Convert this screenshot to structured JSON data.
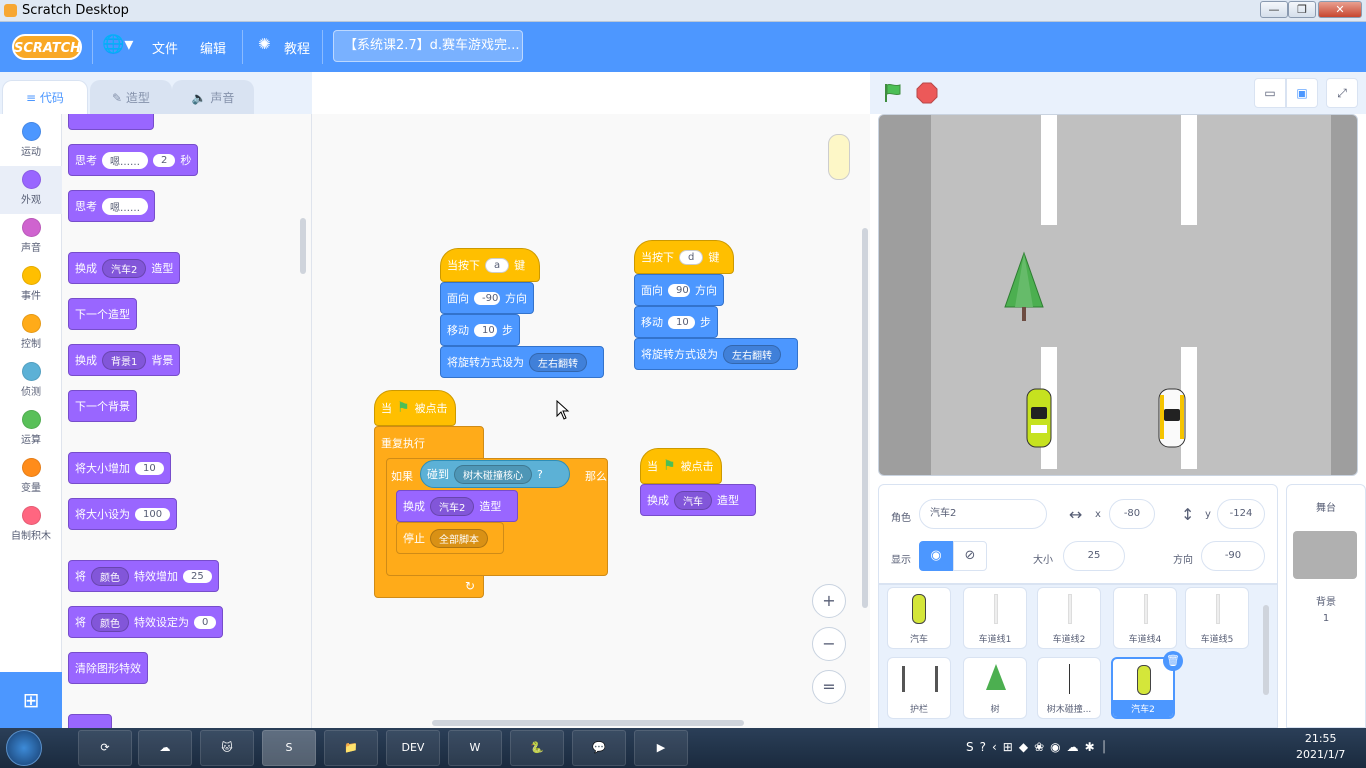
{
  "window": {
    "title": "Scratch Desktop"
  },
  "menubar": {
    "logo": "SCRATCH",
    "file": "文件",
    "edit": "编辑",
    "tutorials": "教程",
    "project_title": "【系统课2.7】d.赛车游戏完..."
  },
  "tabs": {
    "code": "代码",
    "costumes": "造型",
    "sounds": "声音"
  },
  "categories": [
    {
      "label": "运动",
      "color": "#4c97ff"
    },
    {
      "label": "外观",
      "color": "#9966ff"
    },
    {
      "label": "声音",
      "color": "#cf63cf"
    },
    {
      "label": "事件",
      "color": "#ffbf00"
    },
    {
      "label": "控制",
      "color": "#ffab19"
    },
    {
      "label": "侦测",
      "color": "#5cb1d6"
    },
    {
      "label": "运算",
      "color": "#59c059"
    },
    {
      "label": "变量",
      "color": "#ff8c1a"
    },
    {
      "label": "自制积木",
      "color": "#ff6680"
    }
  ],
  "palette": {
    "think_secs": {
      "label": "思考",
      "text": "嗯……",
      "secs": "2",
      "unit": "秒"
    },
    "think": {
      "label": "思考",
      "text": "嗯……"
    },
    "switch_costume": {
      "label": "换成",
      "value": "汽车2",
      "suffix": "造型"
    },
    "next_costume": "下一个造型",
    "switch_backdrop": {
      "label": "换成",
      "value": "背景1",
      "suffix": "背景"
    },
    "next_backdrop": "下一个背景",
    "change_size": {
      "label": "将大小增加",
      "value": "10"
    },
    "set_size": {
      "label": "将大小设为",
      "value": "100"
    },
    "change_effect": {
      "label": "将",
      "effect": "颜色",
      "mid": "特效增加",
      "value": "25"
    },
    "set_effect": {
      "label": "将",
      "effect": "颜色",
      "mid": "特效设定为",
      "value": "0"
    },
    "clear_effects": "清除图形特效"
  },
  "scripts": {
    "key_a": {
      "hat": "当按下",
      "key": "a",
      "key_suffix": "键",
      "dir_label": "面向",
      "dir": "-90",
      "dir_unit": "方向",
      "move_label": "移动",
      "steps": "10",
      "steps_unit": "步",
      "rot_label": "将旋转方式设为",
      "rot": "左右翻转"
    },
    "key_d": {
      "hat": "当按下",
      "key": "d",
      "key_suffix": "键",
      "dir_label": "面向",
      "dir": "90",
      "dir_unit": "方向",
      "move_label": "移动",
      "steps": "10",
      "steps_unit": "步",
      "rot_label": "将旋转方式设为",
      "rot": "左右翻转"
    },
    "flag_main": {
      "hat_pre": "当",
      "hat_post": "被点击",
      "forever": "重复执行",
      "if": "如果",
      "touch": "碰到",
      "touch_target": "树木碰撞核心",
      "q": "?",
      "then": "那么",
      "switch": "换成",
      "costume": "汽车2",
      "costume_suffix": "造型",
      "stop": "停止",
      "stop_opt": "全部脚本"
    },
    "flag_2": {
      "hat_pre": "当",
      "hat_post": "被点击",
      "switch": "换成",
      "costume": "汽车",
      "costume_suffix": "造型"
    }
  },
  "zoom": {
    "in": "+",
    "out": "−",
    "reset": "="
  },
  "sprite_info": {
    "sprite_label": "角色",
    "sprite_name": "汽车2",
    "x_label": "x",
    "x": "-80",
    "y_label": "y",
    "y": "-124",
    "show_label": "显示",
    "size_label": "大小",
    "size": "25",
    "dir_label": "方向",
    "dir": "-90"
  },
  "sprites": [
    {
      "name": "汽车",
      "kind": "car"
    },
    {
      "name": "车道线1",
      "kind": "line"
    },
    {
      "name": "车道线2",
      "kind": "line"
    },
    {
      "name": "车道线4",
      "kind": "line"
    },
    {
      "name": "车道线5",
      "kind": "line"
    },
    {
      "name": "护栏",
      "kind": "rail"
    },
    {
      "name": "树",
      "kind": "tree"
    },
    {
      "name": "树木碰撞...",
      "kind": "thin"
    },
    {
      "name": "汽车2",
      "kind": "car",
      "selected": true
    }
  ],
  "stage_panel": {
    "title": "舞台",
    "backdrops_label": "背景",
    "backdrops_count": "1"
  },
  "taskbar": {
    "time": "21:55",
    "date": "2021/1/7"
  }
}
